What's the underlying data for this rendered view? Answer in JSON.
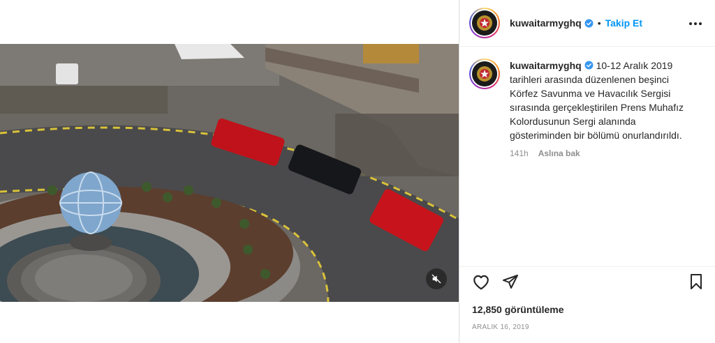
{
  "post": {
    "username": "kuwaitarmyghq",
    "follow_label": "Takip Et",
    "separator": "•",
    "caption_text": "10-12 Aralık 2019 tarihleri arasında düzenlenen beşinci Körfez Savunma ve Havacılık Sergisi sırasında gerçekleştirilen Prens Muhafız Kolordusunun Sergi alanında gösteriminden bir bölümü onurlandırıldı.",
    "time_ago": "141h",
    "see_translation_label": "Aslına bak",
    "views": "12,850 görüntüleme",
    "date": "ARALIK 16, 2019"
  },
  "icons": {
    "verified": "verified-badge-icon",
    "more": "more-options-icon",
    "like": "heart-icon",
    "share": "paper-plane-icon",
    "save": "bookmark-icon",
    "mute": "speaker-muted-icon"
  },
  "colors": {
    "accent": "#0095f6",
    "text": "#262626",
    "muted": "#8e8e8e",
    "verified": "#3897f0"
  }
}
